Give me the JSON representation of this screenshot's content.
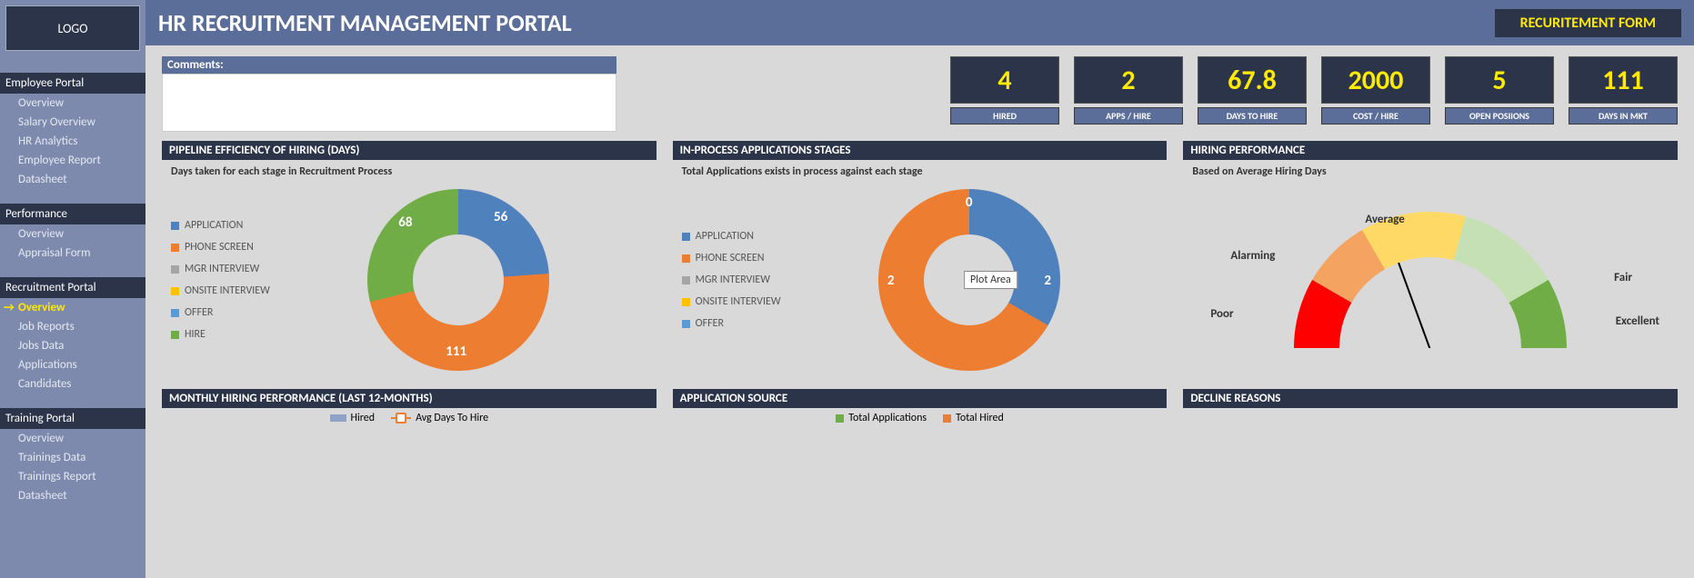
{
  "logo": "LOGO",
  "banner_title": "HR RECRUITMENT MANAGEMENT PORTAL",
  "recruitment_form_btn": "RECURITEMENT FORM",
  "nav": {
    "sec1": {
      "hdr": "Employee Portal",
      "items": [
        "Overview",
        "Salary Overview",
        "HR Analytics",
        "Employee Report",
        "Datasheet"
      ]
    },
    "sec2": {
      "hdr": "Performance",
      "items": [
        "Overview",
        "Appraisal Form"
      ]
    },
    "sec3": {
      "hdr": "Recruitment Portal",
      "items": [
        "Overview",
        "Job Reports",
        "Jobs Data",
        "Applications",
        "Candidates"
      ],
      "active": 0
    },
    "sec4": {
      "hdr": "Training Portal",
      "items": [
        "Overview",
        "Trainings Data",
        "Trainings Report",
        "Datasheet"
      ]
    }
  },
  "comments_hdr": "Comments:",
  "kpis": [
    {
      "val": "4",
      "lbl": "HIRED"
    },
    {
      "val": "2",
      "lbl": "APPS / HIRE"
    },
    {
      "val": "67.8",
      "lbl": "DAYS TO HIRE"
    },
    {
      "val": "2000",
      "lbl": "COST / HIRE"
    },
    {
      "val": "5",
      "lbl": "OPEN POSIIONS"
    },
    {
      "val": "111",
      "lbl": "DAYS IN MKT"
    }
  ],
  "panel1": {
    "hdr": "PIPELINE EFFICIENCY OF HIRING (DAYS)",
    "sub": "Days taken for each stage in Recruitment Process",
    "legend": [
      "APPLICATION",
      "PHONE SCREEN",
      "MGR INTERVIEW",
      "ONSITE INTERVIEW",
      "OFFER",
      "HIRE"
    ],
    "labels": {
      "a": "56",
      "b": "111",
      "c": "68"
    }
  },
  "panel2": {
    "hdr": "IN-PROCESS APPLICATIONS STAGES",
    "sub": "Total Applications exists in process against each stage",
    "legend": [
      "APPLICATION",
      "PHONE SCREEN",
      "MGR INTERVIEW",
      "ONSITE INTERVIEW",
      "OFFER"
    ],
    "labels": {
      "a": "0",
      "b": "2",
      "c": "2"
    },
    "tooltip": "Plot Area"
  },
  "panel3": {
    "hdr": "HIRING PERFORMANCE",
    "sub": "Based on Average Hiring Days",
    "gauge_labels": {
      "poor": "Poor",
      "alarming": "Alarming",
      "average": "Average",
      "fair": "Fair",
      "excellent": "Excellent"
    }
  },
  "panel4": {
    "hdr": "MONTHLY HIRING PERFORMANCE (LAST 12-MONTHS)",
    "leg_a": "Hired",
    "leg_b": "Avg Days To Hire"
  },
  "panel5": {
    "hdr": "APPLICATION SOURCE",
    "leg_a": "Total Applications",
    "leg_b": "Total Hired"
  },
  "panel6": {
    "hdr": "DECLINE REASONS"
  },
  "legend_colors": [
    "#4f81bd",
    "#ed7d31",
    "#a5a5a5",
    "#ffc000",
    "#5b9bd5",
    "#70ad47"
  ],
  "chart_data": [
    {
      "type": "pie",
      "title": "Pipeline Efficiency of Hiring (Days)",
      "categories": [
        "APPLICATION",
        "PHONE SCREEN",
        "MGR INTERVIEW",
        "ONSITE INTERVIEW",
        "OFFER",
        "HIRE"
      ],
      "values": [
        56,
        111,
        0,
        0,
        0,
        68
      ]
    },
    {
      "type": "pie",
      "title": "In-Process Applications Stages",
      "categories": [
        "APPLICATION",
        "PHONE SCREEN",
        "MGR INTERVIEW",
        "ONSITE INTERVIEW",
        "OFFER"
      ],
      "values": [
        0,
        2,
        0,
        0,
        2
      ]
    },
    {
      "type": "gauge",
      "title": "Hiring Performance",
      "categories": [
        "Poor",
        "Alarming",
        "Average",
        "Fair",
        "Excellent"
      ],
      "needle_position": "Alarming"
    }
  ]
}
